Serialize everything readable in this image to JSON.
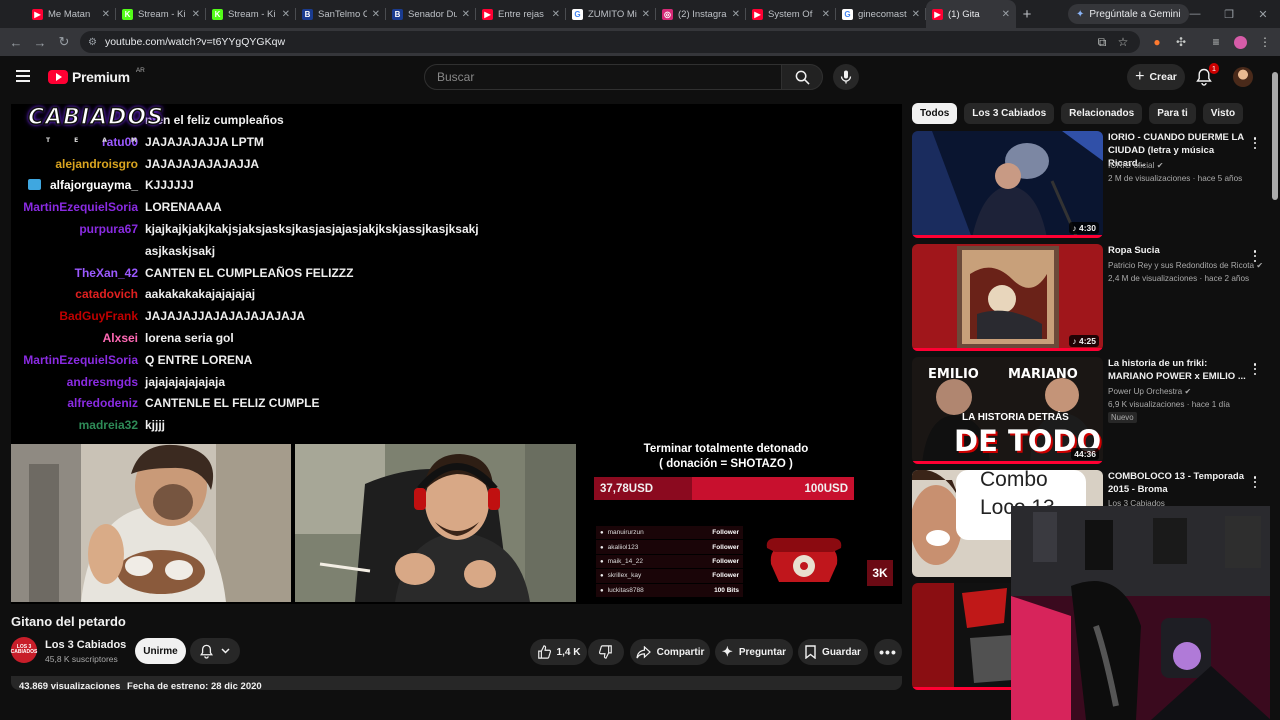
{
  "browser": {
    "tabs": [
      {
        "title": "Me Matan",
        "color": "#ff0033",
        "glyph": "▶"
      },
      {
        "title": "Stream - Ki",
        "color": "#53fc18",
        "glyph": "K"
      },
      {
        "title": "Stream - Ki",
        "color": "#53fc18",
        "glyph": "K"
      },
      {
        "title": "SanTelmo C",
        "color": "#1a3b8f",
        "glyph": "B"
      },
      {
        "title": "Senador Du",
        "color": "#1a3b8f",
        "glyph": "B"
      },
      {
        "title": "Entre rejas",
        "color": "#ff0033",
        "glyph": "▶"
      },
      {
        "title": "ZUMITO Mi",
        "color": "#ffffff",
        "glyph": "G"
      },
      {
        "title": "(2) Instagra",
        "color": "#d62976",
        "glyph": "◎"
      },
      {
        "title": "System Of",
        "color": "#ff0033",
        "glyph": "▶"
      },
      {
        "title": "ginecomast",
        "color": "#ffffff",
        "glyph": "G"
      },
      {
        "title": "(1) Gita",
        "color": "#ff0033",
        "glyph": "▶",
        "active": true
      }
    ],
    "gemini_label": "Pregúntale a Gemini",
    "url": "youtube.com/watch?v=t6YYgQYGKqw"
  },
  "header": {
    "logo_text": "Premium",
    "country": "AR",
    "search_placeholder": "Buscar",
    "create_label": "Crear",
    "notifications_count": "1"
  },
  "video": {
    "logo_text": "CABIADOS",
    "logo_sub": "TEAM",
    "chat": [
      {
        "user": "",
        "color": "#ffffff",
        "msg": "nten el feliz cumpleaños"
      },
      {
        "user": "ratu00",
        "color": "#9b59ff",
        "msg": "JAJAJAJAJJA LPTM"
      },
      {
        "user": "alejandroisgro",
        "color": "#daa520",
        "msg": "JAJAJAJAJAJAJJA"
      },
      {
        "user": "alfajorguayma_",
        "color": "#ffffff",
        "msg": "KJJJJJJ",
        "badge": true
      },
      {
        "user": "MartinEzequielSoria",
        "color": "#8a2be2",
        "msg": "LORENAAAA"
      },
      {
        "user": "purpura67",
        "color": "#8a2be2",
        "msg": "kjajkajkjakjkakjsjaksjasksjkasjasjajasjakjkskjassjkasjksakj\nasjkaskjsakj"
      },
      {
        "user": "TheXan_42",
        "color": "#9b59ff",
        "msg": "CANTEN EL CUMPLEAÑOS FELIZZZ"
      },
      {
        "user": "catadovich",
        "color": "#e02020",
        "msg": "aakakakakajajajajaj"
      },
      {
        "user": "BadGuyFrank",
        "color": "#c00000",
        "msg": "JAJAJAJJAJAJAJAJAJAJA"
      },
      {
        "user": "Alxsei",
        "color": "#ff69b4",
        "msg": "lorena seria gol"
      },
      {
        "user": "MartinEzequielSoria",
        "color": "#8a2be2",
        "msg": "Q ENTRE LORENA"
      },
      {
        "user": "andresmgds",
        "color": "#8a2be2",
        "msg": "jajajajajajajaja"
      },
      {
        "user": "alfredodeniz",
        "color": "#8a2be2",
        "msg": "CANTENLE EL FELIZ CUMPLE"
      },
      {
        "user": "madreia32",
        "color": "#2e8b57",
        "msg": "kjjjj"
      }
    ],
    "goal_title": "Terminar totalmente detonado\n( donación = SHOTAZO )",
    "goal_current": "37,78USD",
    "goal_target": "100USD",
    "goal_progress": 0.3778,
    "followers": [
      {
        "user": "manuirurzun",
        "type": "Follower"
      },
      {
        "user": "akaliiol123",
        "type": "Follower"
      },
      {
        "user": "maik_14_22",
        "type": "Follower"
      },
      {
        "user": "skrillex_kay",
        "type": "Follower"
      },
      {
        "user": "luckitas8788",
        "type": "100 Bits"
      }
    ],
    "badge_text": "3K"
  },
  "info": {
    "title": "Gitano del petardo",
    "channel": "Los 3 Cabiados",
    "channel_avatar_text": "LOS 3 CABIADOS",
    "subscribers": "45,8 K suscriptores",
    "join_label": "Unirme",
    "likes": "1,4 K",
    "share_label": "Compartir",
    "ask_label": "Preguntar",
    "save_label": "Guardar",
    "views": "43.869 visualizaciones",
    "premiere": "Fecha de estreno: 28 dic 2020"
  },
  "sidebar": {
    "chips": [
      {
        "label": "Todos",
        "active": true
      },
      {
        "label": "Los 3 Cabiados"
      },
      {
        "label": "Relacionados"
      },
      {
        "label": "Para ti"
      },
      {
        "label": "Visto"
      }
    ],
    "recommendations": [
      {
        "title": "IORIO -  CUANDO DUERME LA CIUDAD (letra y música Ricard...",
        "channel": "IORIO oficial",
        "verified": true,
        "meta": "2 M de visualizaciones · hace 5 años",
        "duration": "♪ 4:30",
        "thumb": "concert"
      },
      {
        "title": "Ropa Sucia",
        "channel": "Patricio Rey y sus Redonditos de Ricota",
        "verified": true,
        "meta": "2,4 M de visualizaciones · hace 2 años",
        "duration": "♪ 4:25",
        "thumb": "art"
      },
      {
        "title": "La historia de un friki: MARIANO POWER x EMILIO ...",
        "channel": "Power Up Orchestra",
        "verified": true,
        "meta": "6,9 K visualizaciones · hace 1 día",
        "tag": "Nuevo",
        "duration": "44:36",
        "thumb": "interview",
        "thumb_text": {
          "left": "EMILIO",
          "right": "MARIANO",
          "mid": "LA HISTORIA DETRÁS",
          "big": "DE TODO"
        }
      },
      {
        "title": "COMBOLOCO 13 - Temporada 2015 - Broma",
        "channel": "Los 3 Cabiados",
        "verified": false,
        "meta": "",
        "duration": "",
        "thumb": "combo",
        "thumb_text": {
          "top": "Combo",
          "bottom": "Loco 13"
        }
      },
      {
        "title": "",
        "channel": "",
        "meta": "",
        "duration": "",
        "thumb": "poster"
      }
    ]
  }
}
